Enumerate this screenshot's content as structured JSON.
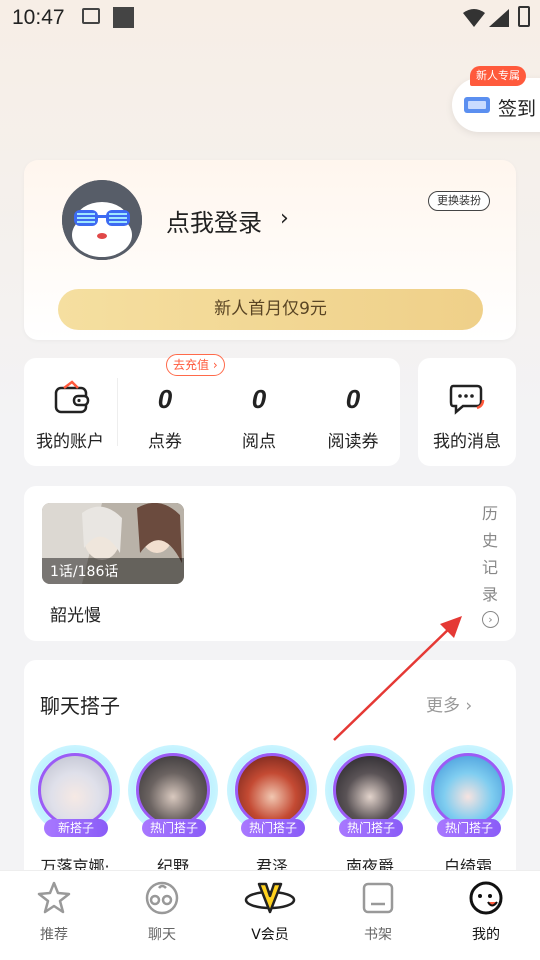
{
  "status": {
    "time": "10:47"
  },
  "signin": {
    "badge": "新人专属",
    "label": "签到"
  },
  "profile": {
    "login_text": "点我登录",
    "chevron": "›",
    "dress_button": "更换装扮",
    "vip_text": "新人首月仅9元"
  },
  "account": {
    "wallet_label": "我的账户",
    "recharge_badge": "去充值 ›",
    "stats": [
      {
        "value": "0",
        "label": "点券"
      },
      {
        "value": "0",
        "label": "阅点"
      },
      {
        "value": "0",
        "label": "阅读券"
      }
    ],
    "messages_label": "我的消息"
  },
  "history": {
    "comic_episode": "1话/186话",
    "comic_title": "韶光慢",
    "side_chars": [
      "历",
      "史",
      "记",
      "录"
    ],
    "side_circle": "›"
  },
  "chat": {
    "title": "聊天搭子",
    "more": "更多 ›",
    "buddies": [
      {
        "tag": "新搭子",
        "name": "万落京娜·",
        "color": "#e8e8ee"
      },
      {
        "tag": "热门搭子",
        "name": "纪野",
        "color": "#3a3a3e"
      },
      {
        "tag": "热门搭子",
        "name": "君泽",
        "color": "#b8442f"
      },
      {
        "tag": "热门搭子",
        "name": "南夜爵",
        "color": "#2e2e33"
      },
      {
        "tag": "热门搭子",
        "name": "白绮霜",
        "color": "#5fb8e6"
      }
    ]
  },
  "tabs": [
    {
      "label": "推荐",
      "icon": "star-icon"
    },
    {
      "label": "聊天",
      "icon": "chat-face-icon"
    },
    {
      "label": "V会员",
      "icon": "vip-icon"
    },
    {
      "label": "书架",
      "icon": "bookshelf-icon"
    },
    {
      "label": "我的",
      "icon": "profile-face-icon",
      "active": true
    }
  ],
  "colors": {
    "accent": "#ff5a3c",
    "vip_gold": "#efd089",
    "buddy_purple": "#9b5cf6"
  }
}
